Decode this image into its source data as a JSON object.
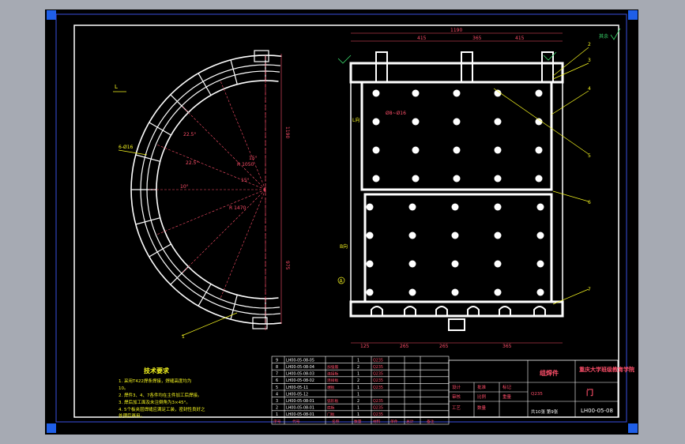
{
  "colors": {
    "viewer_bg": "#a6aab3",
    "paper": "#000000",
    "border": "#ffffff",
    "title_frame": "#3a4fe0",
    "corner_marker": "#1f5fe8",
    "dimension": "#ff4f6a",
    "leader": "#f7f720",
    "weld_symbol": "#39d96b",
    "part": "#ffffff"
  },
  "icons": {
    "corner_markers": "blue-square-marker-icon",
    "section_marker": "circled-letter-icon",
    "roughness": "surface-roughness-icon"
  },
  "drawing": {
    "dim_top_total": "1190",
    "dim_top_left": "415",
    "dim_top_mid": "365",
    "dim_top_right": "415",
    "dim_bottom_1": "125",
    "dim_bottom_2": "265",
    "dim_bottom_3": "265",
    "dim_bottom_4": "365",
    "dim_right_vertical": "1190",
    "dim_left_vertical": "975",
    "dim_arc_r1": "R 1050",
    "dim_arc_r2": "R 1470",
    "dim_hole_callout": "6-Ø16",
    "dim_weld": "Ø8~Ø16",
    "angle_1": "22.5°",
    "angle_2": "22.5°",
    "angle_3": "15°",
    "angle_4": "10°",
    "angle_5": "15°",
    "label_L_left": "L",
    "label_L_plate": "L向",
    "label_A": "A",
    "label_B": "B向",
    "balloons": [
      "1",
      "2",
      "3",
      "4",
      "5",
      "6",
      "7"
    ],
    "roughness_text": "其余",
    "tech_title": "技术要求",
    "tech_notes": [
      "1. 采用T422焊条焊接，焊缝高度均为",
      "   10。",
      "2. 焊件3、4、7各件均在主件加工后焊接。",
      "3. 焊后加工面及未注倒角为3×45°。",
      "4. 5个板夹层焊缝应满足工装，密封性良好之",
      "   处理后再用。"
    ]
  },
  "title_block": {
    "school": "重庆大学班级教育学院",
    "part_name": "组焊件",
    "drawing_no": "LH00-05-08",
    "material": "Q235",
    "sheet": "门",
    "scale_label": "比例",
    "weight_label": "重量",
    "count_label": "共10张 第9张",
    "design_label": "设计",
    "check_label": "审核",
    "process_label": "工艺",
    "approve_label": "批准",
    "mark_label": "标记",
    "qty_label": "数量",
    "row_labels": [
      "序号",
      "代号",
      "名称",
      "数量",
      "材料",
      "单件",
      "总计",
      "备注"
    ]
  },
  "bom": [
    {
      "no": "9",
      "code": "LH00-05-08-05",
      "name": "",
      "qty": "1",
      "mat": "Q235"
    },
    {
      "no": "8",
      "code": "LH00-05-08-04",
      "name": "加强筋",
      "qty": "2",
      "mat": "Q235"
    },
    {
      "no": "7",
      "code": "LH00-05-08-03",
      "name": "连接板",
      "qty": "1",
      "mat": "Q235"
    },
    {
      "no": "6",
      "code": "LH00-05-08-02",
      "name": "连接板",
      "qty": "2",
      "mat": "Q235"
    },
    {
      "no": "5",
      "code": "LH00-05-11",
      "name": "端板",
      "qty": "1",
      "mat": "Q235"
    },
    {
      "no": "4",
      "code": "LH00-05-12",
      "name": "",
      "qty": "1",
      "mat": ""
    },
    {
      "no": "3",
      "code": "LH00-05-08-01",
      "name": "弧形板",
      "qty": "2",
      "mat": "Q235"
    },
    {
      "no": "2",
      "code": "LH00-05-08-01",
      "name": "底板",
      "qty": "1",
      "mat": "Q235"
    },
    {
      "no": "1",
      "code": "LH00-05-08-01",
      "name": "门板",
      "qty": "1",
      "mat": "Q235"
    }
  ]
}
